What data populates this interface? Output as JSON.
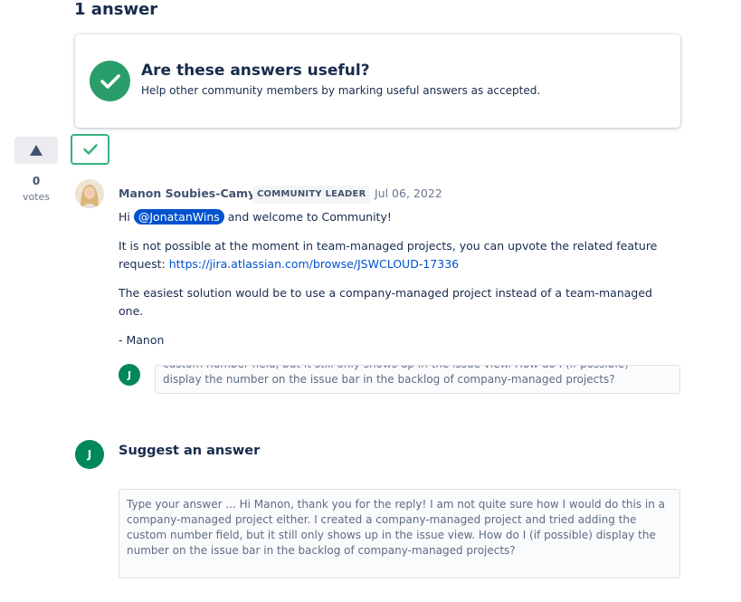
{
  "heading": "1 answer",
  "useful": {
    "title": "Are these answers useful?",
    "subtitle": "Help other community members by marking useful answers as accepted."
  },
  "votes": {
    "count": "0",
    "label": "votes"
  },
  "answer": {
    "author": "Manon Soubies-Camy",
    "badge": "COMMUNITY LEADER",
    "date": "Jul 06, 2022",
    "greeting_prefix": "Hi",
    "mention": "@JonatanWins",
    "greeting_suffix": "and welcome to Community!",
    "p2": "It is not possible at the moment in team-managed projects, you can upvote the related feature request:",
    "link": "https://jira.atlassian.com/browse/JSWCLOUD-17336",
    "p3": "The easiest solution would be to use a company-managed project instead of a team-managed one.",
    "signoff": "- Manon"
  },
  "comment": {
    "avatar_initial": "J",
    "text": "custom number field, but it still only shows up in the issue view. How do I (if possible) display the number on the issue bar in the backlog of company-managed projects?"
  },
  "suggest": {
    "avatar_initial": "J",
    "title": "Suggest an answer",
    "value": " Type your answer ... Hi Manon, thank you for the reply! I am not quite sure how I would do this in a company-managed project either. I created a company-managed project and tried adding the custom number field, but it still only shows up in the issue view. How do I (if possible) display the number on the issue bar in the backlog of company-managed projects?"
  },
  "colors": {
    "accent": "#0052cc",
    "success": "#2a9e6a",
    "accept_border": "#36b37e",
    "avatar_j": "#00875a"
  }
}
